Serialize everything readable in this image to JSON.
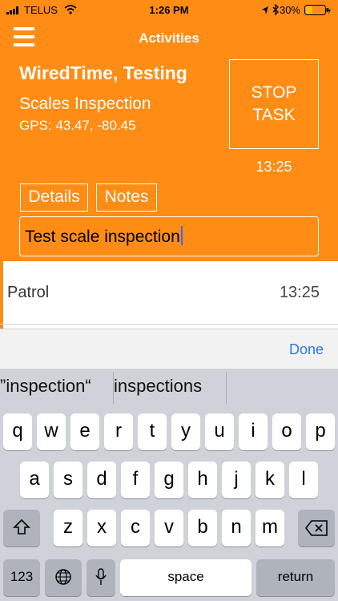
{
  "status_bar": {
    "carrier": "TELUS",
    "time": "1:26 PM",
    "battery_percent": "30%"
  },
  "nav": {
    "title": "Activities"
  },
  "activity": {
    "organization": "WiredTime, Testing",
    "task": "Scales Inspection",
    "gps": "GPS: 43.47, -80.45",
    "stop_line1": "STOP",
    "stop_line2": "TASK",
    "timer": "13:25",
    "details_label": "Details",
    "notes_label": "Notes",
    "note_value": "Test scale inspection"
  },
  "list": {
    "items": [
      {
        "name": "Patrol",
        "time": "13:25"
      }
    ]
  },
  "accessory": {
    "done_label": "Done"
  },
  "keyboard": {
    "suggestions": [
      "“inspection”",
      "inspections"
    ],
    "row1": [
      "q",
      "w",
      "e",
      "r",
      "t",
      "y",
      "u",
      "i",
      "o",
      "p"
    ],
    "row2": [
      "a",
      "s",
      "d",
      "f",
      "g",
      "h",
      "j",
      "k",
      "l"
    ],
    "row3": [
      "z",
      "x",
      "c",
      "v",
      "b",
      "n",
      "m"
    ],
    "numbers_label": "123",
    "space_label": "space",
    "return_label": "return"
  },
  "colors": {
    "accent": "#ff8c14",
    "link": "#2a7ae2"
  }
}
